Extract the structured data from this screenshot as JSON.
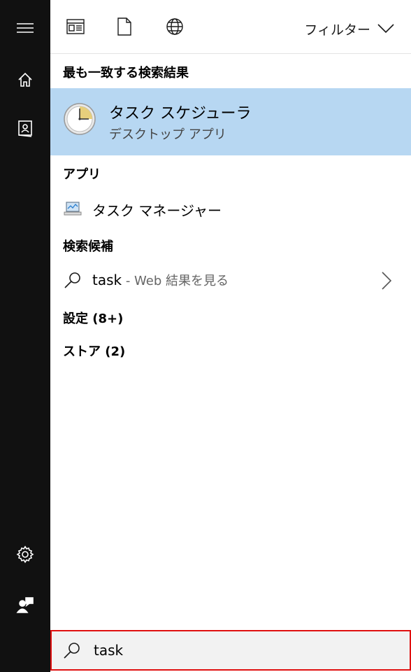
{
  "rail": {
    "items": [
      {
        "icon": "hamburger-menu-icon"
      },
      {
        "icon": "home-icon"
      },
      {
        "icon": "notebook-icon"
      },
      {
        "icon": "settings-gear-icon"
      },
      {
        "icon": "feedback-person-icon"
      }
    ]
  },
  "toolbar": {
    "icons": [
      "apps-filter-icon",
      "documents-filter-icon",
      "web-filter-icon"
    ],
    "filter_label": "フィルター"
  },
  "best_match": {
    "heading": "最も一致する検索結果",
    "title": "タスク スケジューラ",
    "subtitle": "デスクトップ アプリ",
    "icon": "task-scheduler-clock-icon"
  },
  "apps": {
    "heading": "アプリ",
    "items": [
      {
        "label": "タスク マネージャー",
        "icon": "task-manager-icon"
      }
    ]
  },
  "suggestions": {
    "heading": "検索候補",
    "items": [
      {
        "query": "task",
        "hint": " - Web 結果を見る",
        "icon": "search-icon"
      }
    ]
  },
  "settings_group": {
    "label": "設定 (8+)"
  },
  "store_group": {
    "label": "ストア (2)"
  },
  "search": {
    "value": "task"
  },
  "colors": {
    "selection": "#b7d7f2",
    "rail": "#111111",
    "highlight_border": "#e01010"
  }
}
